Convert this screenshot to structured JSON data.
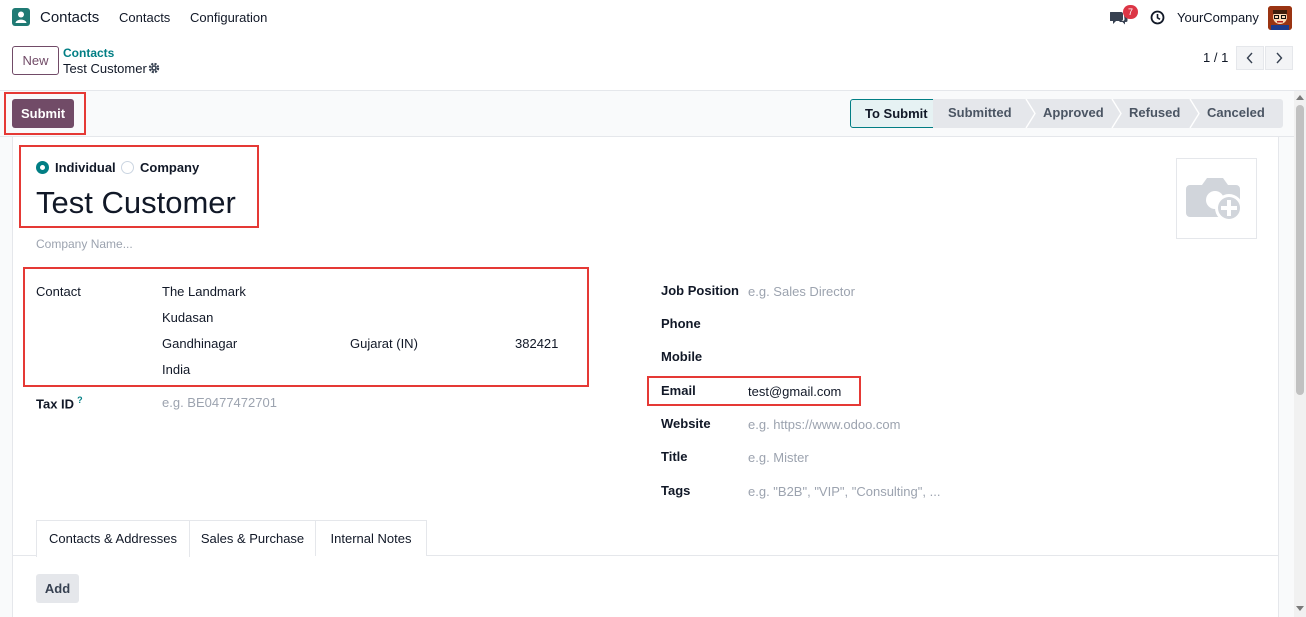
{
  "navbar": {
    "app_name": "Contacts",
    "menu": [
      "Contacts",
      "Configuration"
    ],
    "messages_count": "7",
    "company": "YourCompany"
  },
  "control": {
    "new_label": "New",
    "breadcrumb_parent": "Contacts",
    "breadcrumb_current": "Test Customer",
    "pager": "1 / 1"
  },
  "statusbar": {
    "submit_label": "Submit",
    "stages": [
      "To Submit",
      "Submitted",
      "Approved",
      "Refused",
      "Canceled"
    ],
    "current_stage": "To Submit"
  },
  "form": {
    "type_options": [
      "Individual",
      "Company"
    ],
    "selected_type": "Individual",
    "name": "Test Customer",
    "company_placeholder": "Company Name...",
    "contact_label": "Contact",
    "address": {
      "street": "The Landmark",
      "street2": "Kudasan",
      "city": "Gandhinagar",
      "state": "Gujarat (IN)",
      "zip": "382421",
      "country": "India"
    },
    "tax_id_label": "Tax ID",
    "tax_id_help": "?",
    "tax_id_placeholder": "e.g. BE0477472701",
    "job_position_label": "Job Position",
    "job_position_placeholder": "e.g. Sales Director",
    "phone_label": "Phone",
    "mobile_label": "Mobile",
    "email_label": "Email",
    "email_value": "test@gmail.com",
    "website_label": "Website",
    "website_placeholder": "e.g. https://www.odoo.com",
    "title_label": "Title",
    "title_placeholder": "e.g. Mister",
    "tags_label": "Tags",
    "tags_placeholder": "e.g. \"B2B\", \"VIP\", \"Consulting\", ..."
  },
  "tabs": [
    "Contacts & Addresses",
    "Sales & Purchase",
    "Internal Notes"
  ],
  "active_tab": "Contacts & Addresses",
  "add_label": "Add",
  "colors": {
    "brand": "#714b67",
    "accent": "#017e84",
    "highlight": "#e53935",
    "badge": "#dc3545"
  }
}
